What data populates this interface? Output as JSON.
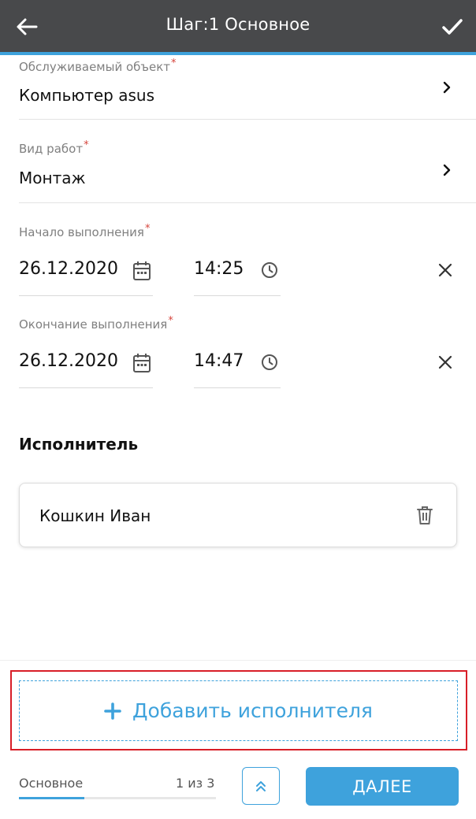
{
  "appbar": {
    "title": "Шаг:1 Основное",
    "back_icon": "arrow-left-icon",
    "confirm_icon": "check-icon",
    "background": "#48494b",
    "accent": "#3ea2dc"
  },
  "fields": {
    "object": {
      "label": "Обслуживаемый объект",
      "required_mark": "*",
      "value": "Компьютер  asus"
    },
    "work_type": {
      "label": "Вид работ",
      "required_mark": "*",
      "value": "Монтаж"
    },
    "start": {
      "label": "Начало выполнения",
      "required_mark": "*",
      "date": "26.12.2020",
      "time": "14:25"
    },
    "end": {
      "label": "Окончание выполнения",
      "required_mark": "*",
      "date": "26.12.2020",
      "time": "14:47"
    }
  },
  "executors": {
    "title": "Исполнитель",
    "items": [
      {
        "name": "Кошкин Иван"
      }
    ],
    "add_label": "Добавить исполнителя"
  },
  "footer": {
    "step_name": "Основное",
    "step_count": "1 из 3",
    "progress_fraction": 0.33,
    "next_label": "ДАЛЕЕ"
  },
  "colors": {
    "accent": "#3ea2dc",
    "required": "#d6453d",
    "highlight": "#d81e27"
  }
}
